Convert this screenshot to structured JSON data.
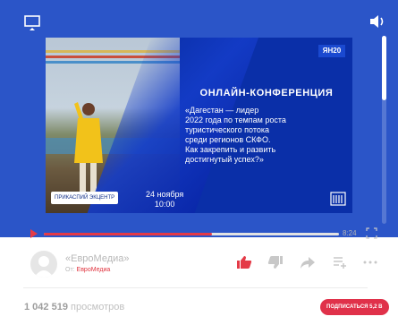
{
  "player": {
    "cast_icon": "cast-icon",
    "volume_icon": "volume-icon",
    "slide": {
      "badge": "ЯН20",
      "title": "ОНЛАЙН-КОНФЕРЕНЦИЯ",
      "body_lines": [
        "«Дагестан — лидер",
        "2022 года по темпам роста",
        "туристического потока",
        "среди регионов СКФО.",
        "Как закрепить и развить",
        "достигнутый успех?»"
      ],
      "footer_logo": "ПРИКАСПИЙ ЭКЦЕНТР",
      "date_line1": "24 ноября",
      "date_line2": "10:00"
    },
    "progress": 0.57,
    "time": "8:24",
    "accent_color": "#e43a47",
    "background_color": "#2b55c8"
  },
  "channel": {
    "name": "«ЕвроМедиа»",
    "from_label": "От: ",
    "from_source": "ЕвроМедиа"
  },
  "actions": [
    "like-icon",
    "dislike-icon",
    "share-icon",
    "add-to-playlist-icon",
    "more-icon"
  ],
  "stats": {
    "views_number": "1 042 519",
    "views_label": " просмотров"
  },
  "subscribe": {
    "label": "ПОДПИСАТЬСЯ 5,2 В"
  }
}
